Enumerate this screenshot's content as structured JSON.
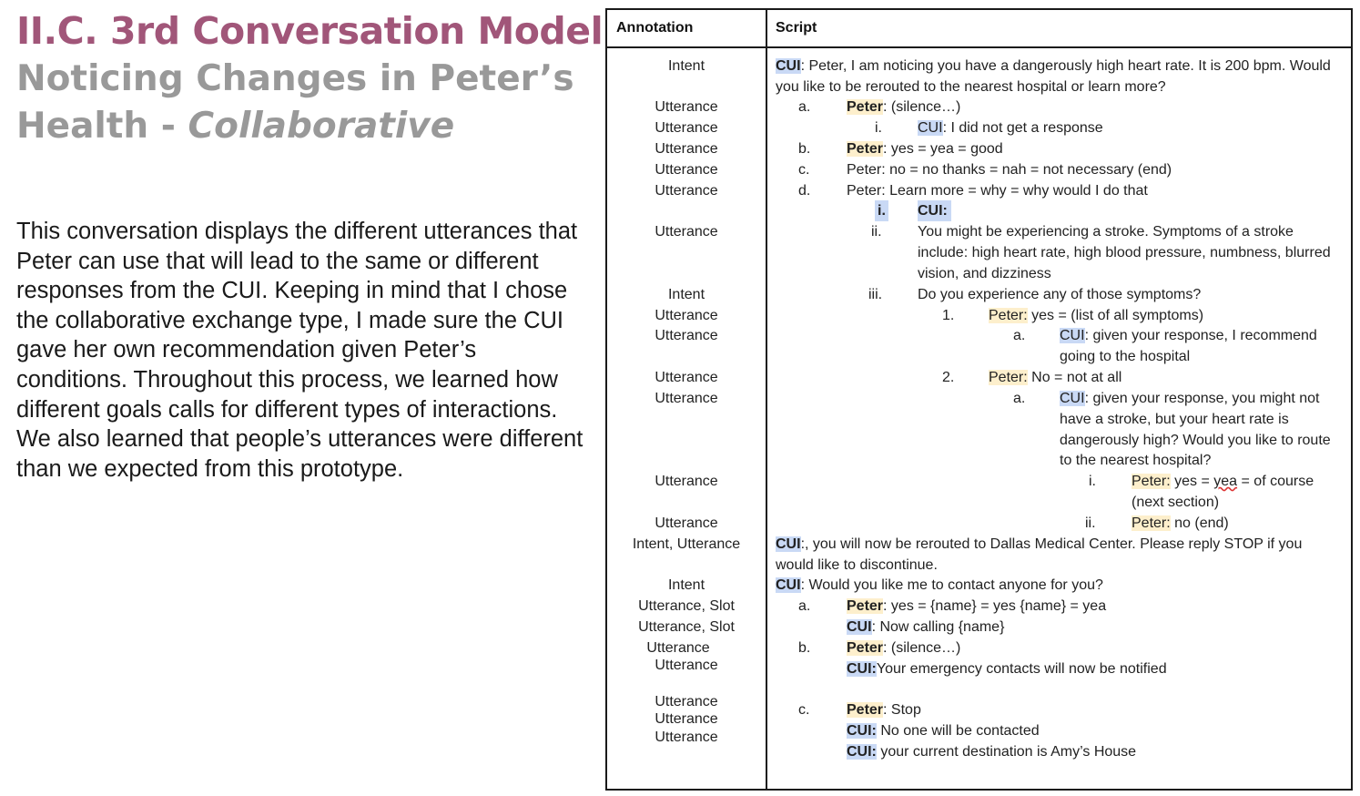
{
  "slide": {
    "title": "II.C. 3rd Conversation Model",
    "subtitle_main": "Noticing Changes in Peter’s Health - ",
    "subtitle_italic": "Collaborative",
    "body": "This conversation displays the different utterances that Peter can use that will lead to the same or different responses from the CUI. Keeping in mind that I chose the collaborative exchange type, I made sure the CUI gave her own recommendation given Peter’s conditions. Throughout this process, we learned how different goals calls for different types of interactions. We also learned that people’s utterances were different than we expected from this prototype."
  },
  "table": {
    "header_annotation": "Annotation",
    "header_script": "Script",
    "annotations": [
      "Intent",
      "Utterance",
      "Utterance",
      "Utterance",
      "Utterance",
      "Utterance",
      "Utterance",
      "Intent",
      "Utterance",
      "Utterance",
      "Utterance",
      "Utterance",
      "Utterance",
      "Utterance",
      "Intent, Utterance",
      "Intent",
      "Utterance, Slot",
      "Utterance, Slot",
      "Utterance",
      "Utterance",
      "Utterance",
      "Utterance",
      "Utterance"
    ],
    "markers": [
      "a.",
      "i.",
      "b.",
      "c.",
      "d.",
      "i.",
      "ii.",
      "iii.",
      "1.",
      "a.",
      "2.",
      "a.",
      "i.",
      "ii.",
      "a.",
      "b.",
      "c."
    ],
    "speakers": {
      "cui": "CUI",
      "peter": "Peter"
    },
    "script": {
      "l1_after": ": Peter, I am noticing you have a dangerously high heart rate. It is 200 bpm. Would",
      "l1b": "you like to be rerouted to the nearest hospital or learn more?",
      "l2_after": ": (silence…)",
      "l3_after": ": I did not get a response",
      "l4_after": ": yes = yea = good",
      "l5": "Peter: no = no thanks = nah = not necessary (end)",
      "l6": "Peter: Learn more =  why  = why would I do that",
      "l7_cui": "CUI:",
      "l8a": "You might be experiencing a stroke. Symptoms of a stroke",
      "l8b": "include: high heart rate, high blood pressure, numbness, blurred",
      "l8c": "vision, and dizziness",
      "l9": "Do you experience any of those symptoms?",
      "l10_peter": "Peter:",
      "l10_after": " yes =  (list of all symptoms)",
      "l11_after": ": given your response, I recommend",
      "l11b": "going to the hospital",
      "l12_peter": "Peter:",
      "l12_after": " No = not at all",
      "l13_after": ": given your response, you might not",
      "l13b": "have a stroke, but your heart rate is",
      "l13c": "dangerously high? Would you like to route",
      "l13d": "to the nearest hospital?",
      "l14_peter": "Peter:",
      "l14_mid": " yes = ",
      "l14_yea": "yea",
      "l14_end": " = of course",
      "l14b": "(next section)",
      "l15_peter": "Peter:",
      "l15_after": " no (end)",
      "l16_after": ":, you will now be rerouted to Dallas Medical Center. Please reply STOP if you",
      "l16b": "would like to discontinue.",
      "l17_after": ": Would you like me to contact anyone for you?",
      "l18_after": ": yes = {name} = yes {name} = yea",
      "l19_after": ": Now calling {name}",
      "l20_after": ": (silence…)",
      "l21_cui": "CUI:",
      "l21_after": "Your emergency contacts will now be notified",
      "l22_after": ": Stop",
      "l23_cui": "CUI:",
      "l23_after": " No one will be contacted",
      "l24_cui": "CUI:",
      "l24_after": " your current destination is Amy’s House"
    }
  }
}
